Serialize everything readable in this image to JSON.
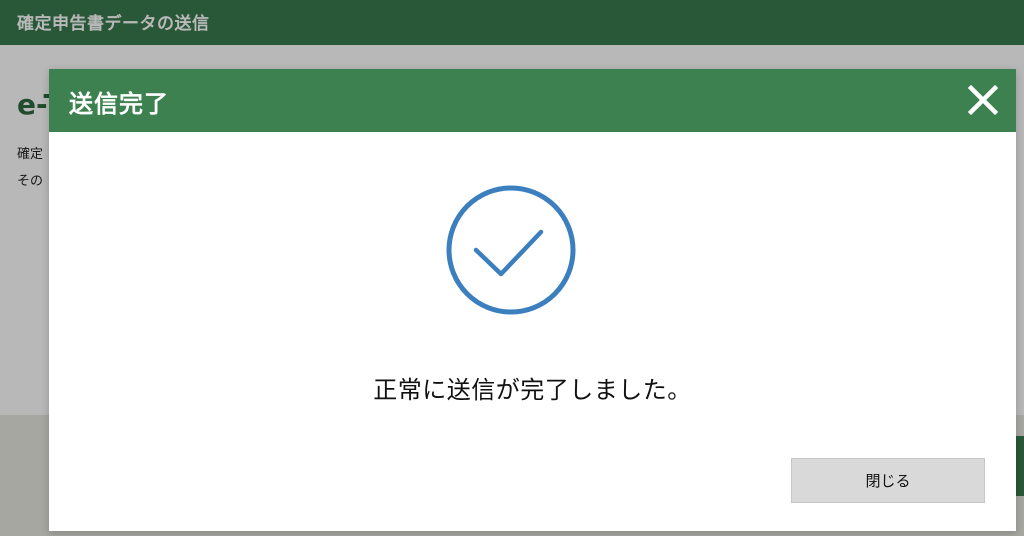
{
  "background": {
    "header_title": "確定申告書データの送信",
    "heading_partial": "e-T",
    "line1_partial": "確定",
    "line2_partial": "その"
  },
  "modal": {
    "title": "送信完了",
    "message": "正常に送信が完了しました。",
    "close_button_label": "閉じる",
    "icons": {
      "close": "close-x-icon",
      "success": "check-circle-icon"
    }
  },
  "colors": {
    "header_green": "#3d8150",
    "check_blue": "#3b7fbf",
    "button_gray": "#d9d9d9"
  }
}
